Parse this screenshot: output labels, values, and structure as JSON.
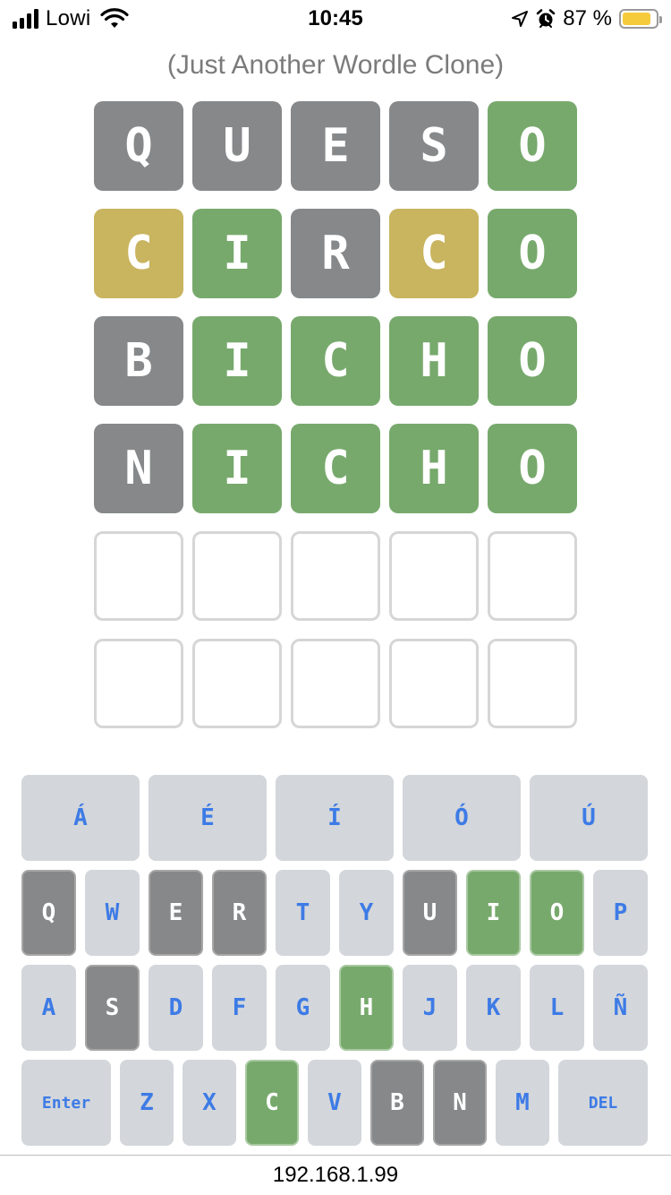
{
  "status_bar": {
    "carrier": "Lowi",
    "time": "10:45",
    "battery_percent": "87 %",
    "battery_level": 0.87,
    "battery_color": "#f5cb3c",
    "icons": [
      "signal-icon",
      "wifi-icon",
      "location-arrow-icon",
      "alarm-icon",
      "battery-icon"
    ]
  },
  "subtitle": "(Just Another Wordle Clone)",
  "colors": {
    "absent": "#86888a",
    "correct": "#77a96c",
    "present": "#c9b45f",
    "key_default": "#d3d6da",
    "key_text": "#3d7be6"
  },
  "board": {
    "rows": [
      [
        {
          "letter": "Q",
          "state": "gray"
        },
        {
          "letter": "U",
          "state": "gray"
        },
        {
          "letter": "E",
          "state": "gray"
        },
        {
          "letter": "S",
          "state": "gray"
        },
        {
          "letter": "O",
          "state": "green"
        }
      ],
      [
        {
          "letter": "C",
          "state": "yellow"
        },
        {
          "letter": "I",
          "state": "green"
        },
        {
          "letter": "R",
          "state": "gray"
        },
        {
          "letter": "C",
          "state": "yellow"
        },
        {
          "letter": "O",
          "state": "green"
        }
      ],
      [
        {
          "letter": "B",
          "state": "gray"
        },
        {
          "letter": "I",
          "state": "green"
        },
        {
          "letter": "C",
          "state": "green"
        },
        {
          "letter": "H",
          "state": "green"
        },
        {
          "letter": "O",
          "state": "green"
        }
      ],
      [
        {
          "letter": "N",
          "state": "gray"
        },
        {
          "letter": "I",
          "state": "green"
        },
        {
          "letter": "C",
          "state": "green"
        },
        {
          "letter": "H",
          "state": "green"
        },
        {
          "letter": "O",
          "state": "green"
        }
      ],
      [
        {
          "letter": "",
          "state": "empty"
        },
        {
          "letter": "",
          "state": "empty"
        },
        {
          "letter": "",
          "state": "empty"
        },
        {
          "letter": "",
          "state": "empty"
        },
        {
          "letter": "",
          "state": "empty"
        }
      ],
      [
        {
          "letter": "",
          "state": "empty"
        },
        {
          "letter": "",
          "state": "empty"
        },
        {
          "letter": "",
          "state": "empty"
        },
        {
          "letter": "",
          "state": "empty"
        },
        {
          "letter": "",
          "state": "empty"
        }
      ]
    ]
  },
  "keyboard": {
    "rows": [
      [
        {
          "label": "Á",
          "state": "default"
        },
        {
          "label": "É",
          "state": "default"
        },
        {
          "label": "Í",
          "state": "default"
        },
        {
          "label": "Ó",
          "state": "default"
        },
        {
          "label": "Ú",
          "state": "default"
        }
      ],
      [
        {
          "label": "Q",
          "state": "gray"
        },
        {
          "label": "W",
          "state": "default"
        },
        {
          "label": "E",
          "state": "gray"
        },
        {
          "label": "R",
          "state": "gray"
        },
        {
          "label": "T",
          "state": "default"
        },
        {
          "label": "Y",
          "state": "default"
        },
        {
          "label": "U",
          "state": "gray"
        },
        {
          "label": "I",
          "state": "green"
        },
        {
          "label": "O",
          "state": "green"
        },
        {
          "label": "P",
          "state": "default"
        }
      ],
      [
        {
          "label": "A",
          "state": "default"
        },
        {
          "label": "S",
          "state": "gray"
        },
        {
          "label": "D",
          "state": "default"
        },
        {
          "label": "F",
          "state": "default"
        },
        {
          "label": "G",
          "state": "default"
        },
        {
          "label": "H",
          "state": "green"
        },
        {
          "label": "J",
          "state": "default"
        },
        {
          "label": "K",
          "state": "default"
        },
        {
          "label": "L",
          "state": "default"
        },
        {
          "label": "Ñ",
          "state": "default"
        }
      ],
      [
        {
          "label": "Enter",
          "state": "default",
          "wide": true
        },
        {
          "label": "Z",
          "state": "default"
        },
        {
          "label": "X",
          "state": "default"
        },
        {
          "label": "C",
          "state": "green"
        },
        {
          "label": "V",
          "state": "default"
        },
        {
          "label": "B",
          "state": "gray"
        },
        {
          "label": "N",
          "state": "gray"
        },
        {
          "label": "M",
          "state": "default"
        },
        {
          "label": "DEL",
          "state": "default",
          "wide": true
        }
      ]
    ]
  },
  "url_bar": {
    "address": "192.168.1.99"
  }
}
